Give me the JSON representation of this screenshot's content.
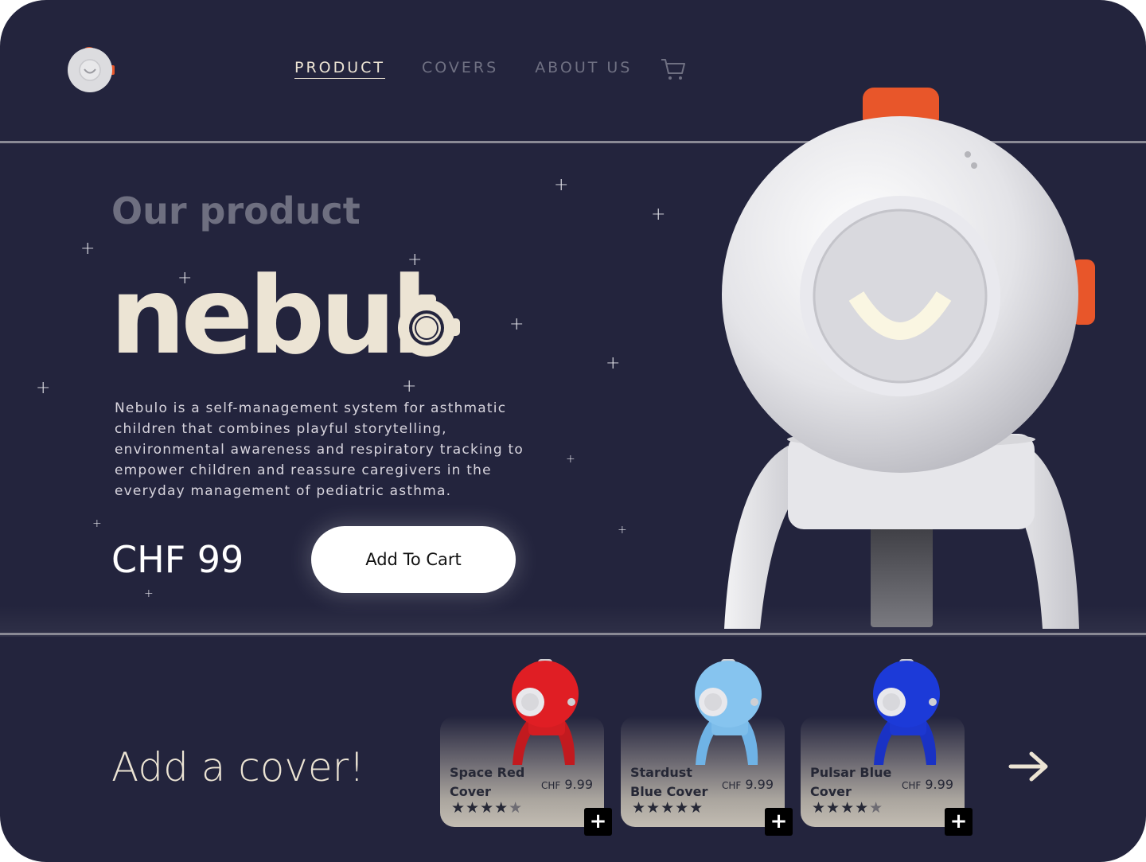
{
  "nav": {
    "items": [
      {
        "label": "PRODUCT",
        "active": true
      },
      {
        "label": "COVERS",
        "active": false
      },
      {
        "label": "ABOUT US",
        "active": false
      }
    ],
    "cart_icon": "cart-icon"
  },
  "hero": {
    "eyebrow": "Our product",
    "brand": "nebul",
    "description": "Nebulo is a self-management system for asthmatic children that combines playful storytelling, environmental awareness and respiratory tracking to empower children and reassure caregivers in the everyday management of pediatric asthma.",
    "price": "CHF 99",
    "add_to_cart_label": "Add To Cart"
  },
  "covers": {
    "title": "Add a cover!",
    "items": [
      {
        "name": "Space Red Cover",
        "currency": "CHF",
        "price": "9.99",
        "rating": 4,
        "max_rating": 5,
        "color": "#e01e24"
      },
      {
        "name": "Stardust Blue Cover",
        "currency": "CHF",
        "price": "9.99",
        "rating": 5,
        "max_rating": 5,
        "color": "#86c4ef"
      },
      {
        "name": "Pulsar Blue Cover",
        "currency": "CHF",
        "price": "9.99",
        "rating": 4,
        "max_rating": 5,
        "color": "#1c3ad8"
      }
    ],
    "next_icon": "arrow-right-icon"
  },
  "colors": {
    "background": "#23243d",
    "cream": "#ece4d4",
    "accent_orange": "#e8562a"
  }
}
